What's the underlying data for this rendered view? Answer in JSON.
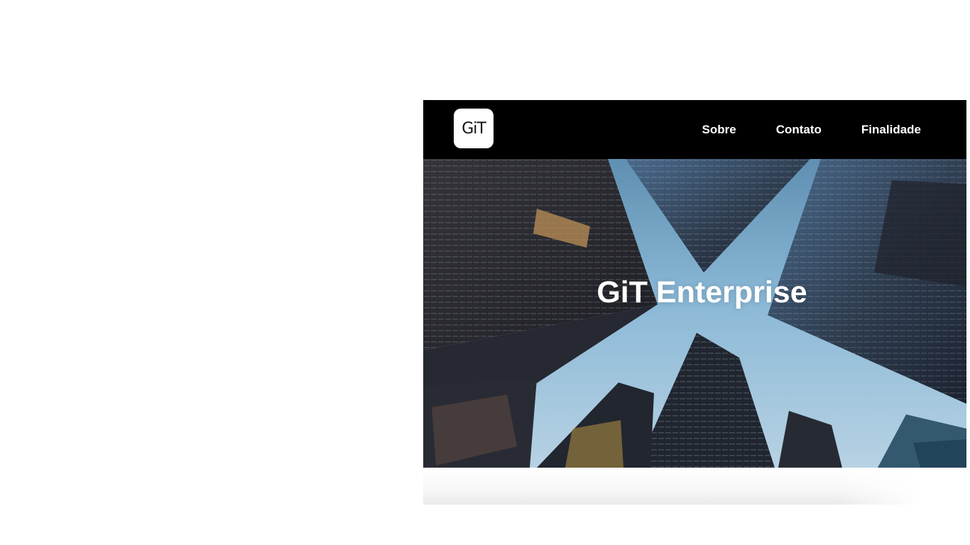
{
  "header": {
    "logo_text": "GiT",
    "nav": [
      {
        "label": "Sobre"
      },
      {
        "label": "Contato"
      },
      {
        "label": "Finalidade"
      }
    ]
  },
  "hero": {
    "title": "GiT Enterprise",
    "background_image": "skyscrapers-looking-up"
  }
}
